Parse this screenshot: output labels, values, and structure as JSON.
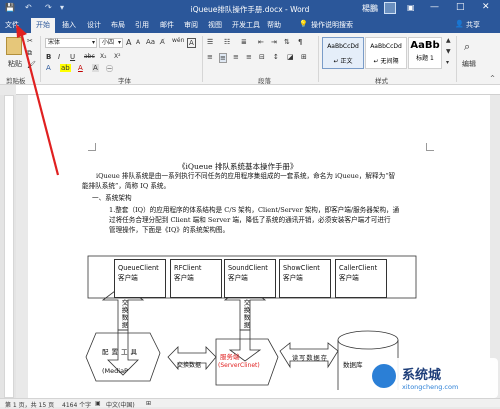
{
  "window": {
    "title": "iQueue排队操作手册.docx - Word",
    "user": "楊鵬",
    "controls": [
      "—",
      "□",
      "✕"
    ]
  },
  "tabs": [
    {
      "label": "文件"
    },
    {
      "label": "开始"
    },
    {
      "label": "插入"
    },
    {
      "label": "设计"
    },
    {
      "label": "布局"
    },
    {
      "label": "引用"
    },
    {
      "label": "邮件"
    },
    {
      "label": "审阅"
    },
    {
      "label": "视图"
    },
    {
      "label": "开发工具"
    },
    {
      "label": "帮助"
    },
    {
      "label": "操作说明搜索"
    },
    {
      "label": "共享"
    }
  ],
  "ribbon": {
    "paste_label": "粘贴",
    "font_name": "宋体",
    "font_size": "小四",
    "font_grow": "A",
    "font_shrink": "A",
    "aa": "Aa",
    "wen": "wén",
    "bold": "B",
    "italic": "I",
    "underline": "U",
    "strike": "abc",
    "sub": "X₂",
    "sup": "X²",
    "styles": [
      {
        "preview": "AaBbCcDd",
        "name": "↵ 正文"
      },
      {
        "preview": "AaBbCcDd",
        "name": "↵ 无间隔"
      },
      {
        "preview": "AaBb",
        "name": "标题 1"
      }
    ],
    "edit_label": "编辑",
    "groups": {
      "clipboard": "剪贴板",
      "font": "字体",
      "paragraph": "段落",
      "styles": "样式"
    }
  },
  "document": {
    "title": "《iQueue 排队系统基本操作手册》",
    "intro_1": "iQueue 排队系统是由一系列执行不同任务的应用程序集组成的一套系统，命名为 iQueue，解释为“智",
    "intro_2": "能排队系统”，简称 IQ 系统。",
    "section_1": "一、系统架构",
    "para_1": "1.整套（IQ）的应用程序的体系结构是 C/S 架构，Client/Server 架构，即客户端/服务器架构，通",
    "para_2": "过将任务合理分配到 Client 端和 Server 端，降低了系统的通讯开销，必须安装客户端才可进行",
    "para_3": "管理操作，下面是《IQ》的系统架构图。",
    "clients": [
      {
        "name": "QueueClient",
        "sub": "客户端"
      },
      {
        "name": "RFClient",
        "sub": "客户端"
      },
      {
        "name": "SoundClient",
        "sub": "客户端"
      },
      {
        "name": "ShowClient",
        "sub": "客户端"
      },
      {
        "name": "CallerClient",
        "sub": "客户端"
      }
    ],
    "exchange_data": "交换数据",
    "config_tool": "配置工具",
    "config_tool_en": "(MediaP",
    "server_cn": "服务端",
    "server_en": "(ServerClinet)",
    "read_write": "读写数据存",
    "database": "数据库",
    "accent_red": "#e02020"
  },
  "status": {
    "page": "第 1 页，共 15 页",
    "words": "4164 个字",
    "lang": "中文(中国)"
  },
  "watermark": {
    "text": "系统城",
    "url": "xitongcheng.com"
  }
}
